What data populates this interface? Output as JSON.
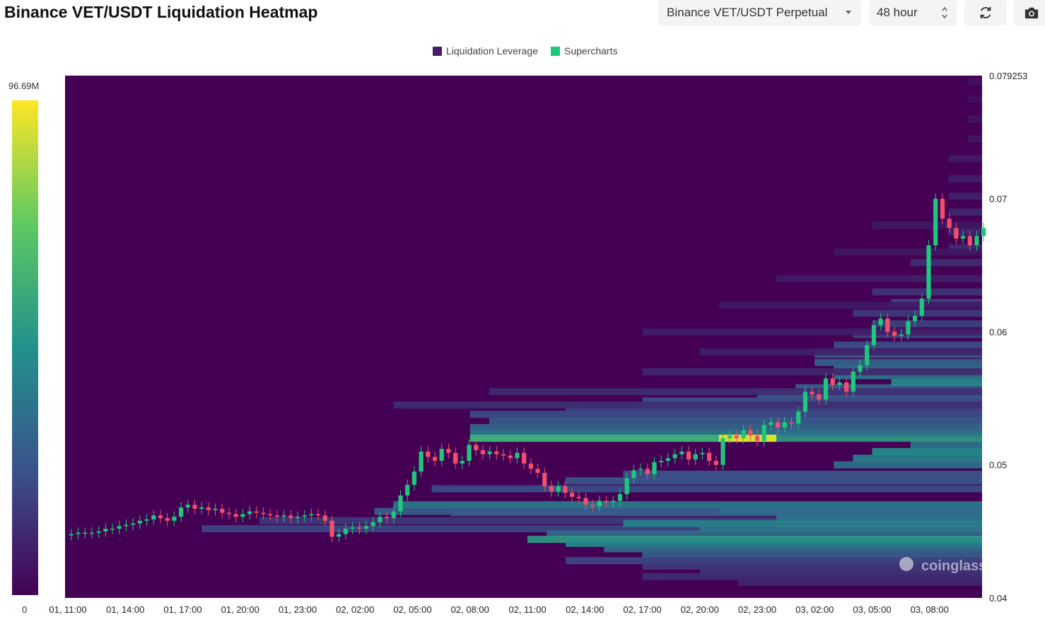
{
  "header": {
    "title": "Binance VET/USDT Liquidation Heatmap",
    "pair_select": "Binance VET/USDT Perpetual",
    "period_select": "48 hour",
    "refresh_icon": "refresh-icon",
    "camera_icon": "camera-icon"
  },
  "legend": [
    {
      "label": "Liquidation Leverage",
      "color": "#4a1a6b"
    },
    {
      "label": "Supercharts",
      "color": "#1fc77b"
    }
  ],
  "color_scale": {
    "max_label": "96.69M",
    "min_label": "0"
  },
  "watermark": "coinglass",
  "chart_data": {
    "type": "heatmap",
    "title": "Binance VET/USDT Liquidation Heatmap",
    "xlabel": "",
    "ylabel": "",
    "x_ticks": [
      "01, 11:00",
      "01, 14:00",
      "01, 17:00",
      "01, 20:00",
      "01, 23:00",
      "02, 02:00",
      "02, 05:00",
      "02, 08:00",
      "02, 11:00",
      "02, 14:00",
      "02, 17:00",
      "02, 20:00",
      "02, 23:00",
      "03, 02:00",
      "03, 05:00",
      "03, 08:00"
    ],
    "y_ticks": [
      "0.079253",
      "0.07",
      "0.06",
      "0.05",
      "0.04"
    ],
    "y_tick_values": [
      0.079253,
      0.07,
      0.06,
      0.05,
      0.04
    ],
    "ylim": [
      0.04,
      0.079253
    ],
    "xlim_hours_from_01_11": [
      0,
      48
    ],
    "colorscale_range": [
      0,
      96.69
    ],
    "colorscale_unit": "M",
    "price_close": [
      0.0448,
      0.0449,
      0.0449,
      0.0449,
      0.045,
      0.0452,
      0.0452,
      0.0454,
      0.0455,
      0.0456,
      0.0458,
      0.0459,
      0.0462,
      0.046,
      0.0458,
      0.0461,
      0.0468,
      0.047,
      0.0467,
      0.0468,
      0.0466,
      0.0467,
      0.0464,
      0.0463,
      0.0461,
      0.0463,
      0.0465,
      0.0464,
      0.0463,
      0.0462,
      0.0461,
      0.0462,
      0.046,
      0.0461,
      0.0462,
      0.0463,
      0.0462,
      0.0458,
      0.0446,
      0.0448,
      0.0452,
      0.0453,
      0.0452,
      0.0454,
      0.0457,
      0.0461,
      0.046,
      0.0465,
      0.0477,
      0.0485,
      0.0495,
      0.051,
      0.0506,
      0.0503,
      0.0512,
      0.0509,
      0.0501,
      0.0503,
      0.0515,
      0.0511,
      0.0508,
      0.051,
      0.0508,
      0.0507,
      0.0505,
      0.0509,
      0.0501,
      0.0497,
      0.0494,
      0.0484,
      0.048,
      0.0484,
      0.0479,
      0.0476,
      0.0475,
      0.047,
      0.0469,
      0.0473,
      0.0472,
      0.0473,
      0.0478,
      0.049,
      0.0496,
      0.0497,
      0.0493,
      0.0502,
      0.0503,
      0.0505,
      0.0508,
      0.051,
      0.0504,
      0.0508,
      0.0509,
      0.0503,
      0.05,
      0.052,
      0.0522,
      0.052,
      0.0526,
      0.0522,
      0.0518,
      0.053,
      0.0532,
      0.0528,
      0.0532,
      0.0531,
      0.054,
      0.0555,
      0.0553,
      0.0549,
      0.0565,
      0.056,
      0.0562,
      0.0555,
      0.057,
      0.0575,
      0.059,
      0.0605,
      0.061,
      0.06,
      0.0597,
      0.0598,
      0.0608,
      0.0612,
      0.0625,
      0.0665,
      0.07,
      0.0685,
      0.0678,
      0.067,
      0.0672,
      0.0665,
      0.0672,
      0.0678
    ]
  }
}
